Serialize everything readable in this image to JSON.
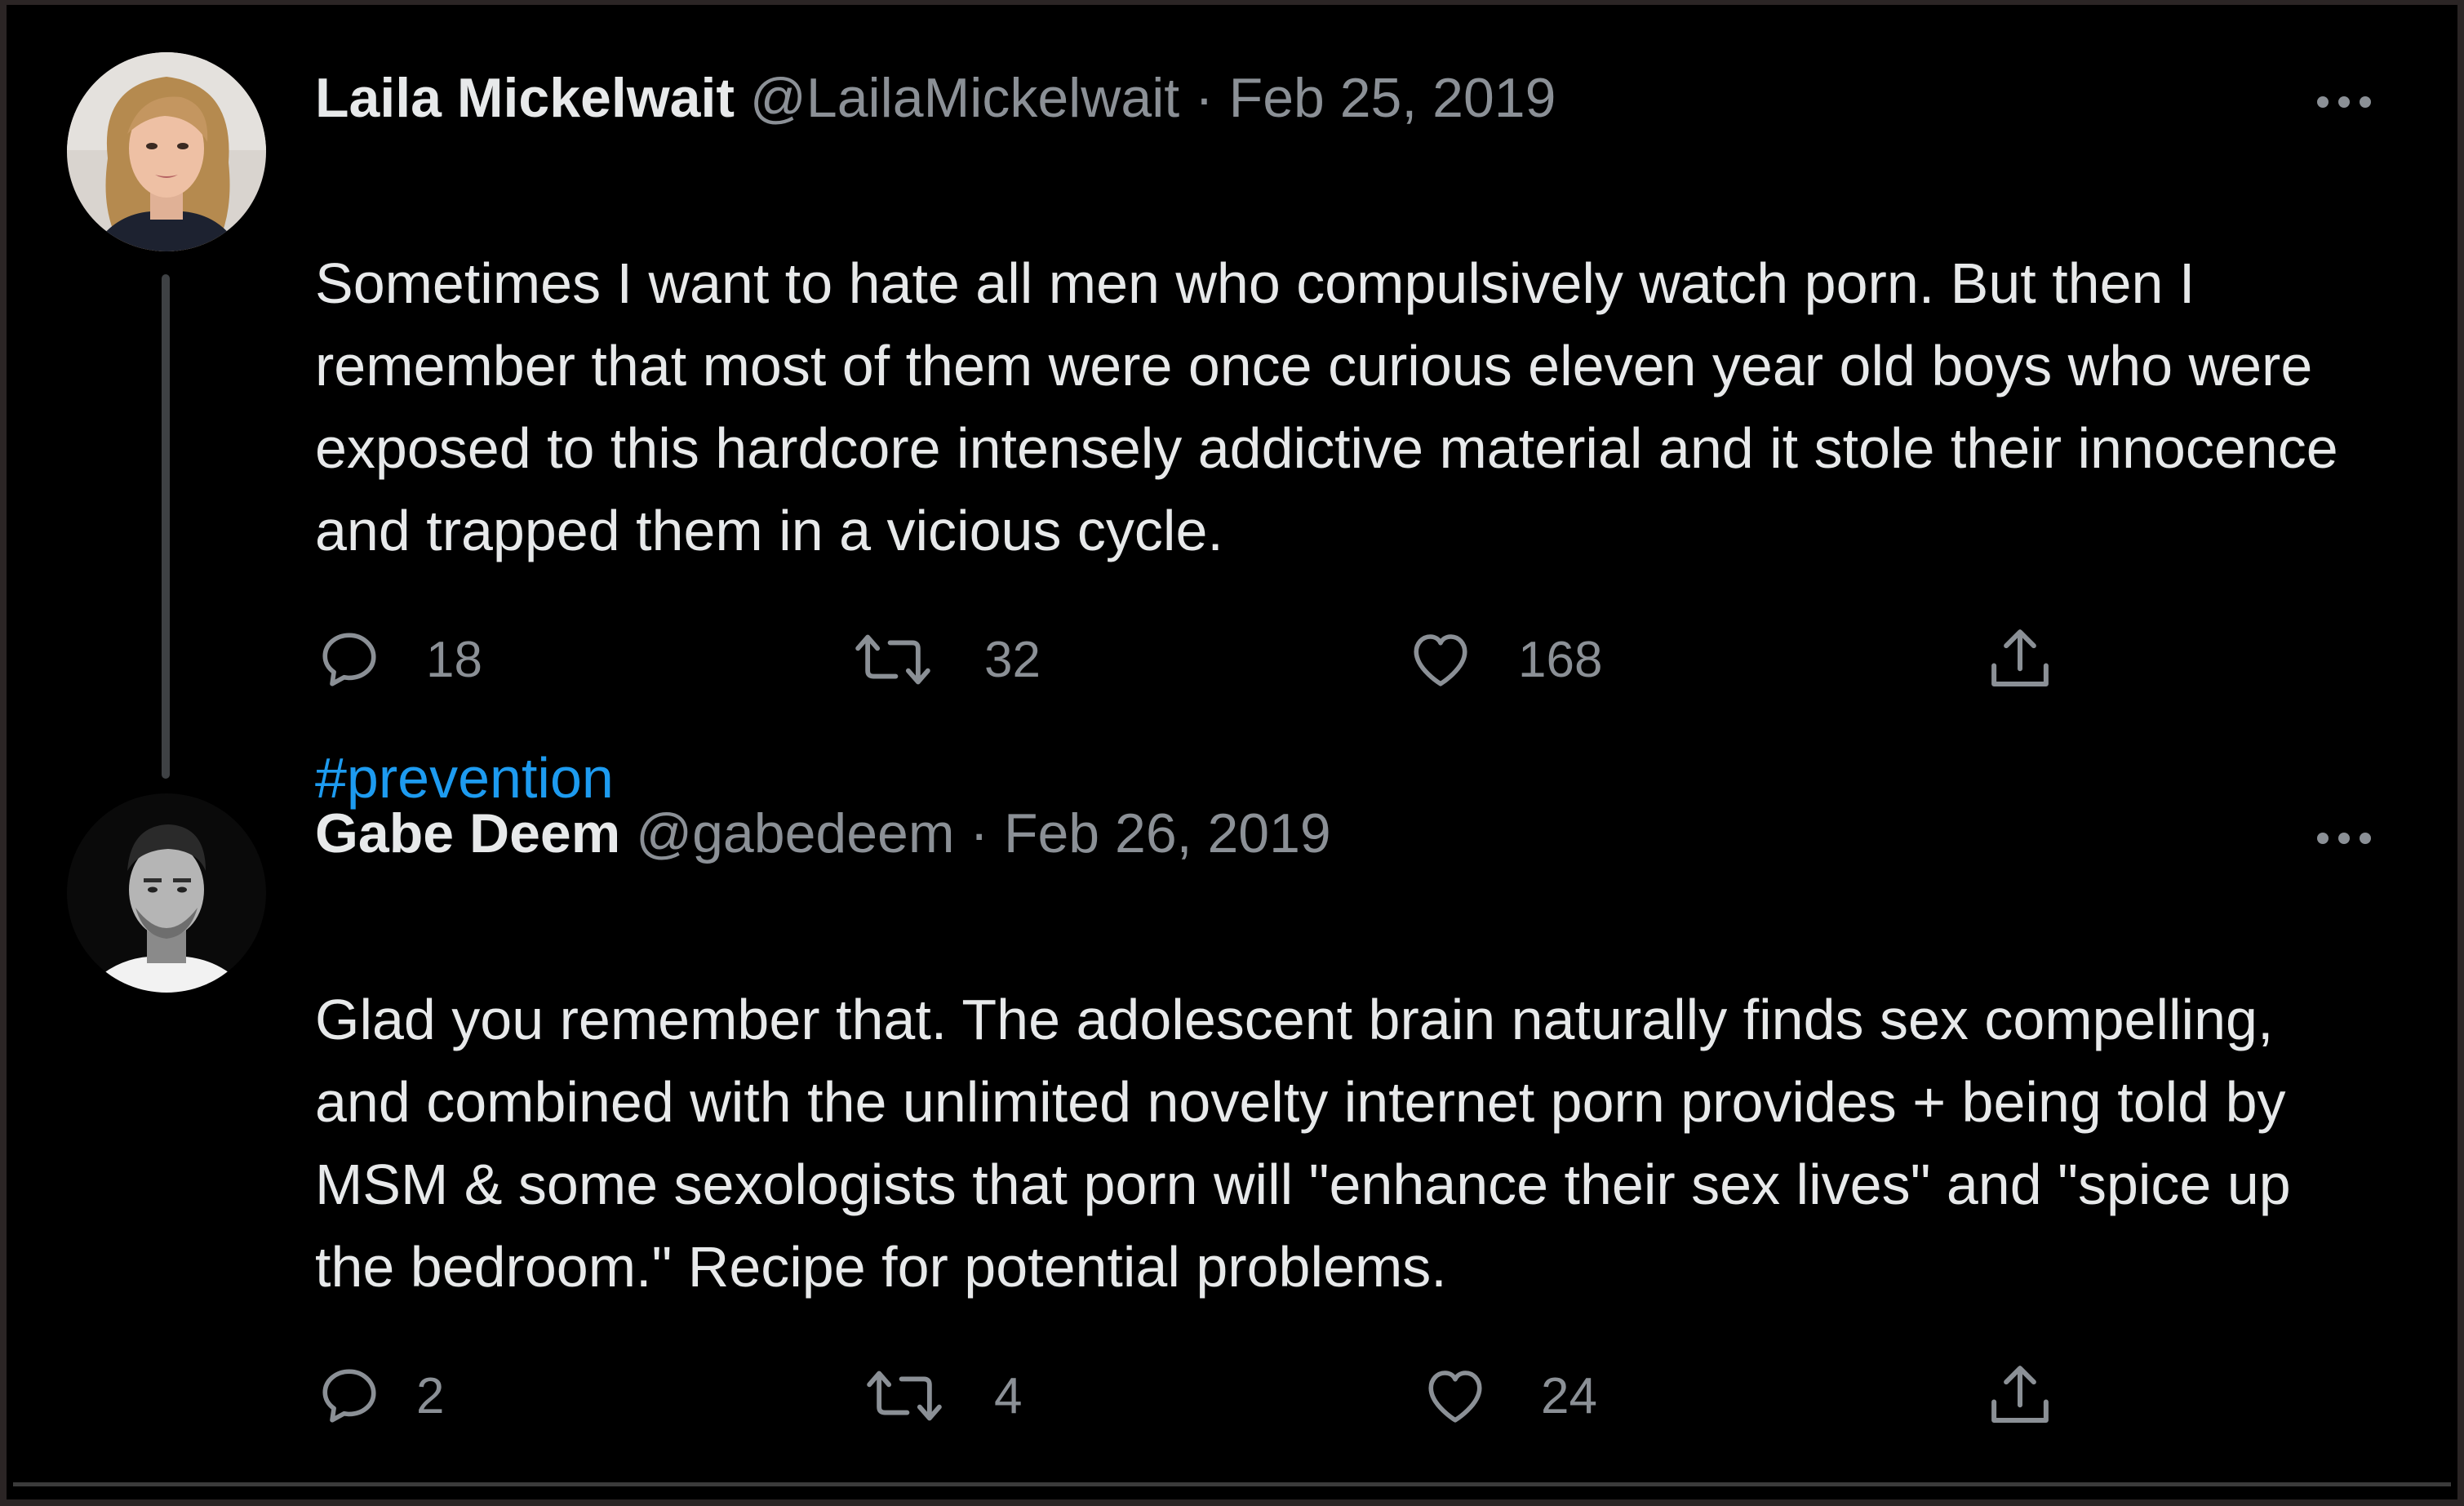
{
  "tweets": [
    {
      "display_name": "Laila Mickelwait",
      "handle": "@LailaMickelwait",
      "separator": "·",
      "date": "Feb 25, 2019",
      "text": "Sometimes I want to hate all men who compulsively watch porn. But then I remember that most of them were once curious eleven year old boys who were exposed to this hardcore intensely addictive material and it stole their innocence and trapped them in a vicious cycle.",
      "hashtag": "#prevention",
      "replies": "18",
      "retweets": "32",
      "likes": "168",
      "avatar_icon": "woman-portrait"
    },
    {
      "display_name": "Gabe Deem",
      "handle": "@gabedeem",
      "separator": "·",
      "date": "Feb 26, 2019",
      "text": "Glad you remember that. The adolescent brain naturally finds sex compelling, and combined with the unlimited novelty internet porn provides + being told by MSM & some sexologists that porn will \"enhance their sex lives\" and \"spice up the bedroom.\" Recipe for potential problems.",
      "replies": "2",
      "retweets": "4",
      "likes": "24",
      "avatar_icon": "man-portrait"
    }
  ],
  "icons": {
    "reply": "speech-bubble-icon",
    "retweet": "retweet-arrows-icon",
    "like": "heart-icon",
    "share": "share-upload-icon",
    "more": "more-dots-icon"
  },
  "colors": {
    "background": "#000000",
    "text": "#e7e9ea",
    "secondary": "#8b9096",
    "link": "#1d9bf0",
    "thread_line": "#3e4144"
  }
}
